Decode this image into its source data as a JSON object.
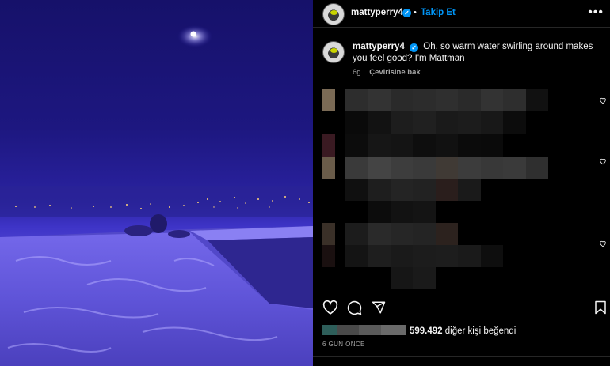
{
  "post": {
    "username": "mattyperry4",
    "follow_label": "Takip Et",
    "separator": "•",
    "more_label": "•••"
  },
  "caption": {
    "username": "mattyperry4",
    "text": "Oh, so warm water swirling around makes you feel good? I'm Mattman",
    "age": "6g",
    "see_translation": "Çevirisine bak"
  },
  "likes": {
    "count": "599.492",
    "rest": "diğer kişi beğendi"
  },
  "date": "6 GÜN ÖNCE",
  "colors": {
    "accent": "#0095f6",
    "photo_night": "#1d1780",
    "photo_water": "#6b60e0"
  },
  "icons": {
    "like": "heart-icon",
    "comment": "comment-icon",
    "share": "paper-plane-icon",
    "save": "bookmark-icon",
    "more": "more-options-icon",
    "verified": "verified-badge-icon"
  }
}
